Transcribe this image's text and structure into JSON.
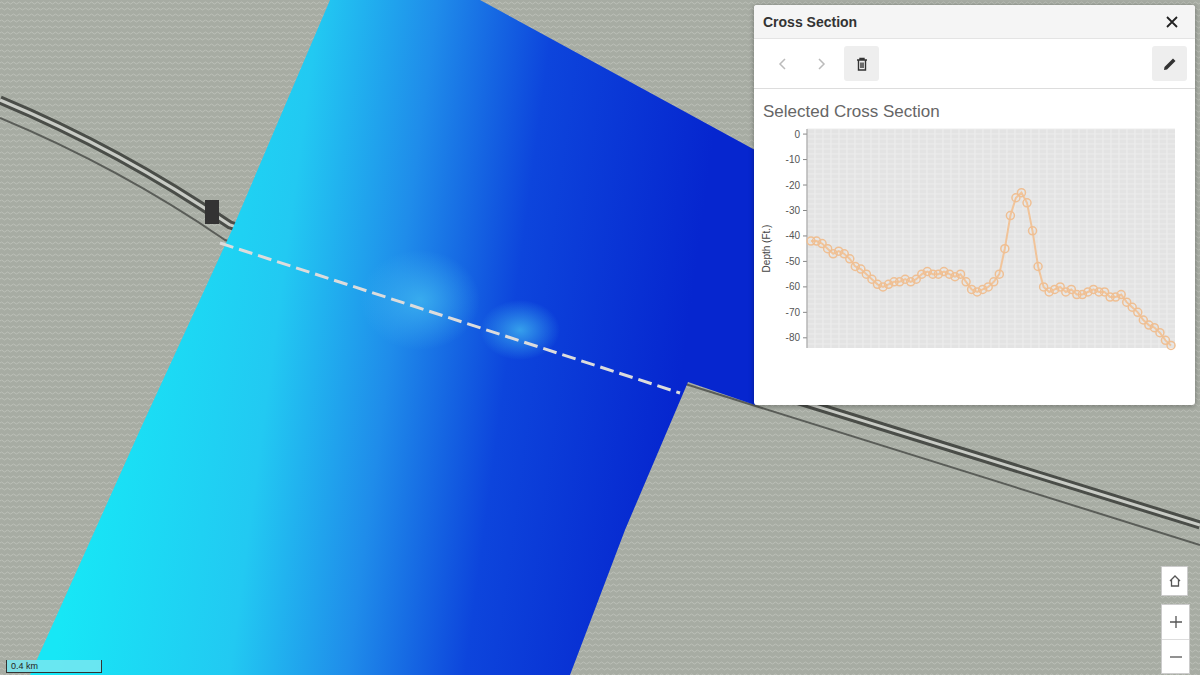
{
  "panel": {
    "title": "Cross Section",
    "nav": {
      "previous": {
        "disabled": true
      },
      "next": {
        "disabled": true
      }
    }
  },
  "chart": {
    "title": "Selected Cross Section",
    "y_axis_label": "Depth (Ft.)",
    "y_ticks": [
      "0",
      "-10",
      "-20",
      "-30",
      "-40",
      "-50",
      "-60",
      "-70",
      "-80"
    ],
    "series": [
      {
        "name": "Depth",
        "values": [
          -42,
          -42,
          -43,
          -45,
          -47,
          -46,
          -47,
          -49,
          -52,
          -53,
          -55,
          -57,
          -59,
          -60,
          -59,
          -58,
          -58,
          -57,
          -58,
          -57,
          -55,
          -54,
          -55,
          -55,
          -54,
          -55,
          -56,
          -55,
          -58,
          -61,
          -62,
          -61,
          -60,
          -58,
          -55,
          -45,
          -32,
          -25,
          -23,
          -27,
          -38,
          -52,
          -60,
          -62,
          -61,
          -60,
          -62,
          -61,
          -63,
          -63,
          -62,
          -61,
          -62,
          -62,
          -64,
          -64,
          -63,
          -66,
          -68,
          -70,
          -73,
          -75,
          -76,
          -78,
          -81,
          -83
        ]
      }
    ]
  },
  "map": {
    "scale_label": "0.4 km"
  }
}
